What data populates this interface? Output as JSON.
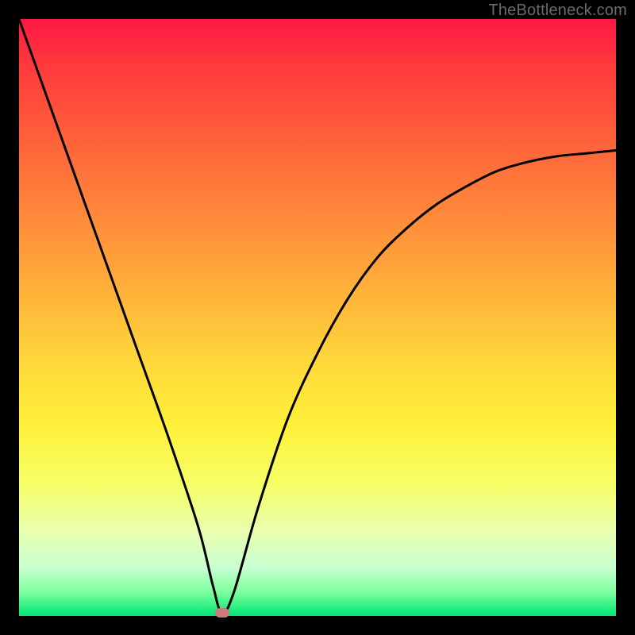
{
  "site": {
    "watermark": "TheBottleneck.com"
  },
  "chart_data": {
    "type": "line",
    "title": "",
    "xlabel": "",
    "ylabel": "",
    "xlim": [
      0,
      1
    ],
    "ylim": [
      0,
      1
    ],
    "series": [
      {
        "name": "curve",
        "x": [
          0.0,
          0.05,
          0.1,
          0.15,
          0.2,
          0.25,
          0.3,
          0.325,
          0.34,
          0.36,
          0.4,
          0.45,
          0.5,
          0.55,
          0.6,
          0.65,
          0.7,
          0.75,
          0.8,
          0.85,
          0.9,
          0.95,
          1.0
        ],
        "y": [
          1.0,
          0.86,
          0.72,
          0.58,
          0.44,
          0.3,
          0.15,
          0.05,
          0.005,
          0.04,
          0.18,
          0.33,
          0.44,
          0.53,
          0.6,
          0.65,
          0.69,
          0.72,
          0.745,
          0.76,
          0.77,
          0.775,
          0.78
        ]
      }
    ],
    "marker": {
      "x": 0.34,
      "y": 0.005,
      "color": "#cc7a7a"
    },
    "background_gradient": {
      "top": "#ff1744",
      "mid": "#ffd93a",
      "bottom": "#00e676"
    }
  }
}
